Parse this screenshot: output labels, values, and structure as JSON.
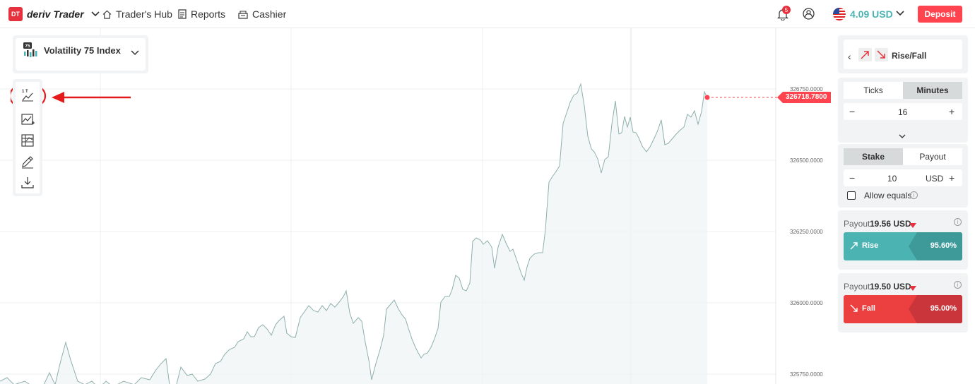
{
  "header": {
    "brand_badge": "DT",
    "brand_name": "deriv Trader",
    "nav": [
      {
        "label": "Trader's Hub"
      },
      {
        "label": "Reports"
      },
      {
        "label": "Cashier"
      }
    ],
    "notification_count": "5",
    "balance": "4.09 USD",
    "deposit_label": "Deposit"
  },
  "market": {
    "icon_label": "75",
    "name": "Volatility 75 Index"
  },
  "toolbar": {
    "tools": [
      "chart-type-icon",
      "indicators-icon",
      "drawing-list-icon",
      "pencil-icon",
      "download-icon"
    ],
    "chart_type_label": "1 T"
  },
  "chart": {
    "current_price": "326718.7800",
    "y_ticks": [
      "326750.0000",
      "326500.0000",
      "326250.0000",
      "326000.0000",
      "325750.0000"
    ]
  },
  "trade": {
    "contract_type": "Rise/Fall",
    "duration_tabs": [
      "Ticks",
      "Minutes"
    ],
    "duration_active": "Minutes",
    "duration_value": "16",
    "stake_tabs": [
      "Stake",
      "Payout"
    ],
    "stake_active": "Stake",
    "stake_value": "10",
    "currency": "USD",
    "allow_equals_label": "Allow equals",
    "rise": {
      "payout_label": "Payout",
      "payout_value": "19.56 USD",
      "button_label": "Rise",
      "percent": "95.60%"
    },
    "fall": {
      "payout_label": "Payout",
      "payout_value": "19.50 USD",
      "button_label": "Fall",
      "percent": "95.00%"
    }
  },
  "colors": {
    "brand_red": "#ff444f",
    "rise": "#4bb4b3",
    "fall": "#ec3f3f",
    "line": "#8fb0ac"
  }
}
